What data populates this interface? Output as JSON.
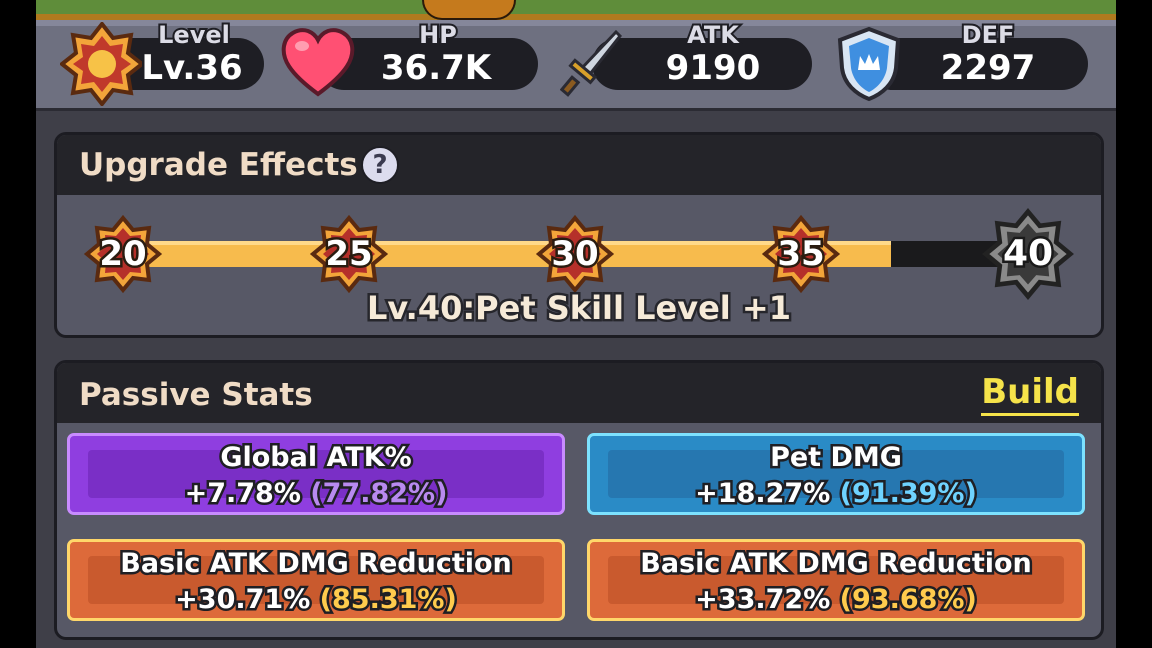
{
  "stats": {
    "level": {
      "label": "Level",
      "value": "Lv.36"
    },
    "hp": {
      "label": "HP",
      "value": "36.7K"
    },
    "atk": {
      "label": "ATK",
      "value": "9190"
    },
    "def": {
      "label": "DEF",
      "value": "2297"
    }
  },
  "upgrade_effects": {
    "title": "Upgrade Effects",
    "help_label": "?",
    "milestones": [
      "20",
      "25",
      "30",
      "35",
      "40"
    ],
    "progress_fraction": 0.87,
    "effect_text": "Lv.40:Pet Skill Level +1"
  },
  "passive_stats": {
    "title": "Passive Stats",
    "build_label": "Build",
    "cards": [
      {
        "name": "Global ATK%",
        "value": "+7.78%",
        "max": "(77.82%)",
        "color": "purple"
      },
      {
        "name": "Pet DMG",
        "value": "+18.27%",
        "max": "(91.39%)",
        "color": "blue"
      },
      {
        "name": "Basic ATK DMG Reduction",
        "value": "+30.71%",
        "max": "(85.31%)",
        "color": "orange"
      },
      {
        "name": "Basic ATK DMG Reduction",
        "value": "+33.72%",
        "max": "(93.68%)",
        "color": "orange"
      }
    ]
  },
  "colors": {
    "progress_fill": "#f7bb4d",
    "build_link": "#f5e34a",
    "title_text": "#f0dcc6"
  }
}
